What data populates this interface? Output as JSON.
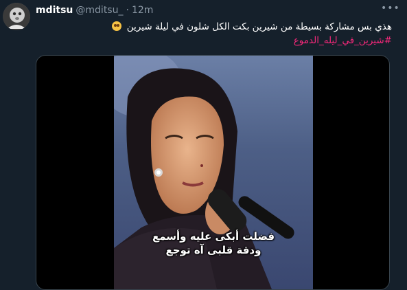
{
  "tweet": {
    "display_name": "mditsu",
    "handle": "@mditsu_",
    "separator": "·",
    "time": "12m",
    "more_icon": "ellipsis-icon",
    "text": "هذي بس مشاركة بسيطة من شيرين بكت الكل شلون في ليلة شيرين",
    "emoji": "pleading-face-emoji",
    "hashtag": "#شيرين_في_ليله_الدموع"
  },
  "media": {
    "subtitle_line1": "فضلت أبكى عليه وأسمع",
    "subtitle_line2": "ودقة قلبى آه توجع"
  },
  "colors": {
    "background": "#15202b",
    "muted": "#8b98a5",
    "hashtag": "#f5287a",
    "border": "#38444d"
  }
}
